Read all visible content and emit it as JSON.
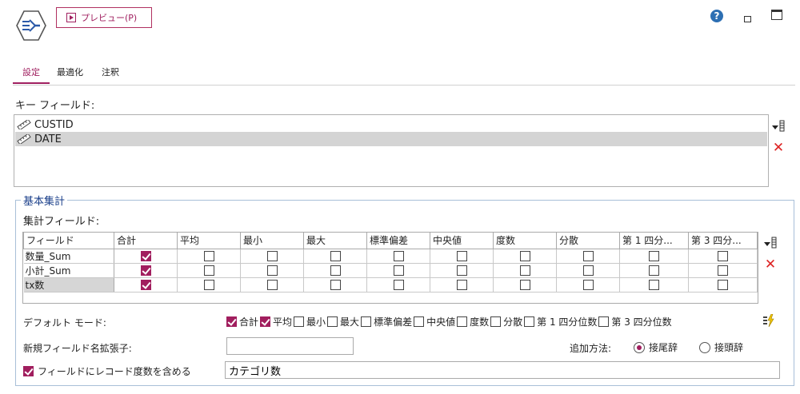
{
  "header": {
    "preview_label": "プレビュー(P)"
  },
  "tabs": [
    {
      "label": "設定",
      "active": true
    },
    {
      "label": "最適化",
      "active": false
    },
    {
      "label": "注釈",
      "active": false
    }
  ],
  "key_fields": {
    "label": "キー フィールド:",
    "items": [
      {
        "name": "CUSTID",
        "selected": false
      },
      {
        "name": "DATE",
        "selected": true
      }
    ]
  },
  "basic_agg": {
    "legend": "基本集計",
    "agg_fields_label": "集計フィールド:",
    "columns": [
      "フィールド",
      "合計",
      "平均",
      "最小",
      "最大",
      "標準偏差",
      "中央値",
      "度数",
      "分散",
      "第 1 四分...",
      "第 3 四分..."
    ],
    "rows": [
      {
        "field": "数量_Sum",
        "checks": [
          true,
          false,
          false,
          false,
          false,
          false,
          false,
          false,
          false,
          false
        ],
        "selected": false
      },
      {
        "field": "小計_Sum",
        "checks": [
          true,
          false,
          false,
          false,
          false,
          false,
          false,
          false,
          false,
          false
        ],
        "selected": false
      },
      {
        "field": "tx数",
        "checks": [
          true,
          false,
          false,
          false,
          false,
          false,
          false,
          false,
          false,
          false
        ],
        "selected": true
      }
    ]
  },
  "default_mode": {
    "label": "デフォルト モード:",
    "items": [
      {
        "label": "合計",
        "checked": true
      },
      {
        "label": "平均",
        "checked": true
      },
      {
        "label": "最小",
        "checked": false
      },
      {
        "label": "最大",
        "checked": false
      },
      {
        "label": "標準偏差",
        "checked": false
      },
      {
        "label": "中央値",
        "checked": false
      },
      {
        "label": "度数",
        "checked": false
      },
      {
        "label": "分散",
        "checked": false
      },
      {
        "label": "第 1 四分位数",
        "checked": false
      },
      {
        "label": "第 3 四分位数",
        "checked": false
      }
    ]
  },
  "extension": {
    "label": "新規フィールド名拡張子:",
    "value": "",
    "add_method_label": "追加方法:",
    "suffix_label": "接尾辞",
    "prefix_label": "接頭辞",
    "selected": "suffix"
  },
  "include_count": {
    "label": "フィールドにレコード度数を含める",
    "checked": true,
    "value": "カテゴリ数"
  },
  "colors": {
    "accent": "#a11e5e",
    "group_title": "#1a3f8a",
    "delete": "#dd2222"
  },
  "icons": [
    "aggregate-node-icon",
    "play-icon",
    "help-icon",
    "minimize-icon",
    "maximize-icon",
    "ruler-icon",
    "field-picker-icon",
    "delete-icon",
    "apply-default-icon"
  ]
}
